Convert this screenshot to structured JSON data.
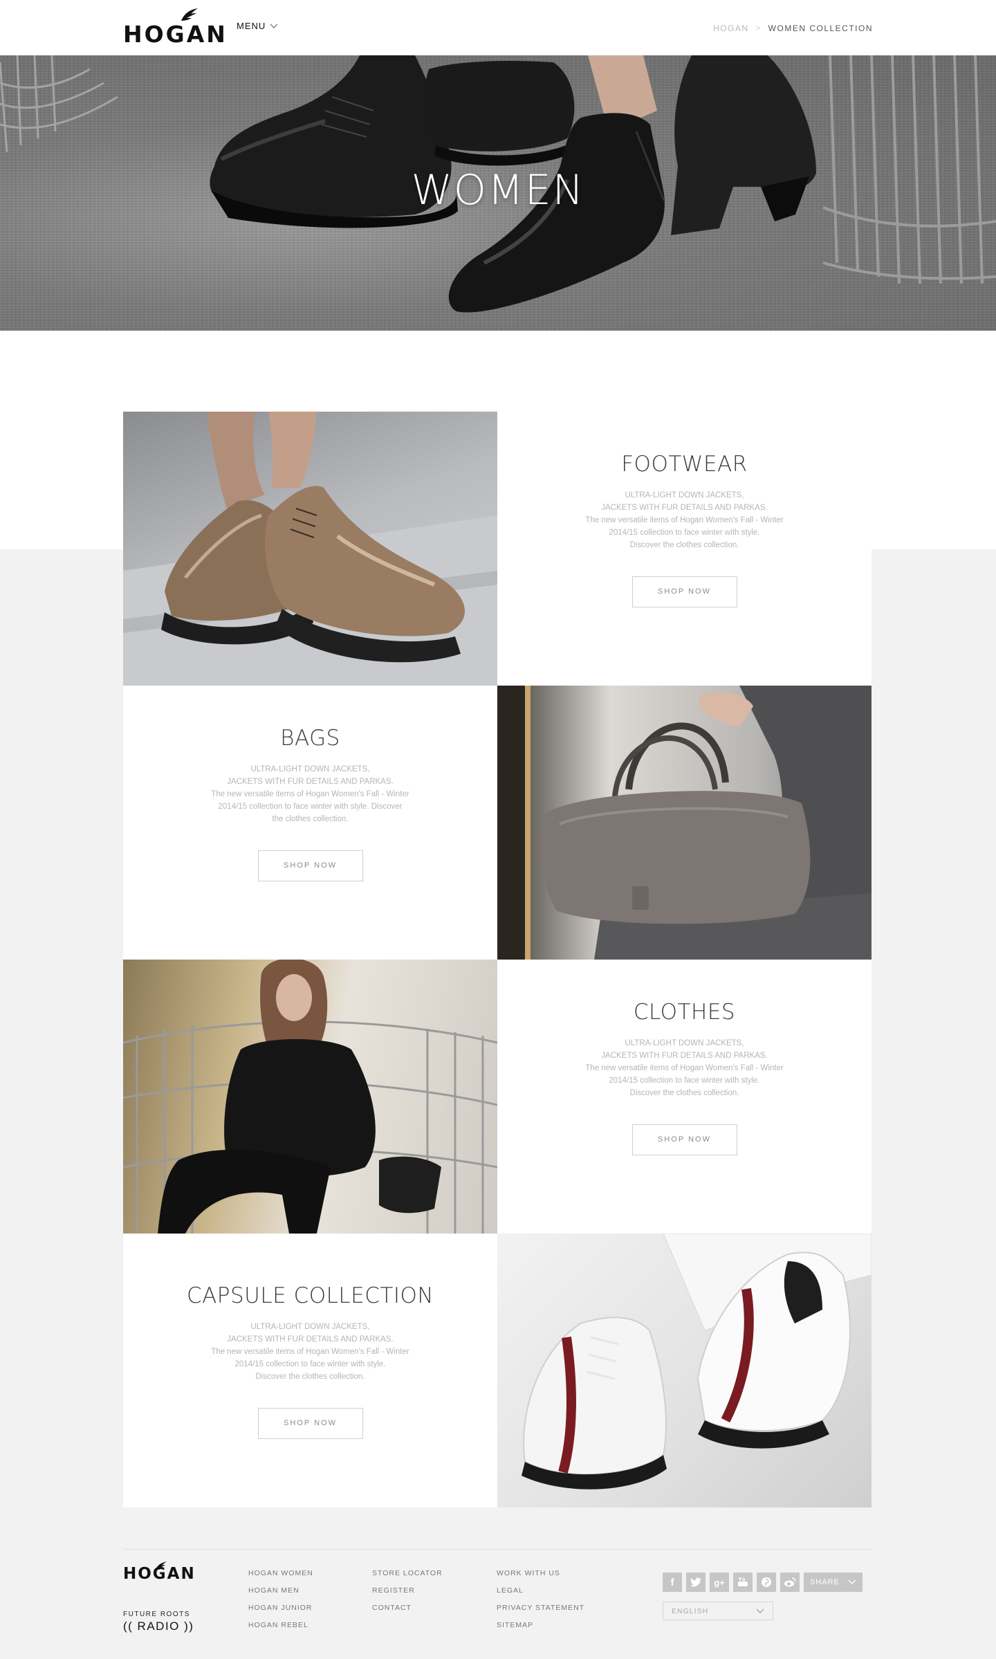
{
  "header": {
    "logo": "HOGAN",
    "menu_label": "MENU",
    "breadcrumb": {
      "home": "HOGAN",
      "separator": ">",
      "current": "WOMEN COLLECTION"
    }
  },
  "hero": {
    "title": "WOMEN"
  },
  "sections": [
    {
      "title": "FOOTWEAR",
      "desc_1": "ULTRA-LIGHT DOWN JACKETS,",
      "desc_2": "JACKETS WITH FUR DETAILS AND PARKAS.",
      "desc_3": "The new versatile items of Hogan Women's Fall - Winter 2014/15 collection to face winter with style.",
      "desc_4": "Discover the clothes collection.",
      "button": "SHOP NOW"
    },
    {
      "title": "BAGS",
      "desc_1": "ULTRA-LIGHT DOWN JACKETS,",
      "desc_2": "JACKETS WITH FUR DETAILS AND PARKAS.",
      "desc_3": "The new versatile items of Hogan Women's Fall - Winter 2014/15 collection to face winter with style. Discover",
      "desc_4": "the clothes collection.",
      "button": "SHOP NOW"
    },
    {
      "title": "CLOTHES",
      "desc_1": "ULTRA-LIGHT DOWN JACKETS,",
      "desc_2": "JACKETS WITH FUR DETAILS AND PARKAS.",
      "desc_3": "The new versatile items of Hogan Women's Fall - Winter 2014/15 collection to face winter with style.",
      "desc_4": "Discover the clothes collection.",
      "button": "SHOP NOW"
    },
    {
      "title": "CAPSULE COLLECTION",
      "desc_1": "ULTRA-LIGHT DOWN JACKETS,",
      "desc_2": "JACKETS WITH FUR DETAILS AND PARKAS.",
      "desc_3": "The new versatile items of Hogan Women's Fall - Winter 2014/15 collection to face winter with style.",
      "desc_4": "Discover the clothes collection.",
      "button": "SHOP NOW"
    }
  ],
  "footer": {
    "logo": "HOGAN",
    "radio_top": "FUTURE ROOTS",
    "radio_bottom": "(( RADIO ))",
    "col1": [
      "HOGAN WOMEN",
      "HOGAN MEN",
      "HOGAN JUNIOR",
      "HOGAN REBEL"
    ],
    "col2": [
      "STORE LOCATOR",
      "REGISTER",
      "CONTACT"
    ],
    "col3": [
      "WORK WITH US",
      "LEGAL",
      "PRIVACY STATEMENT",
      "SITEMAP"
    ],
    "social_icons": [
      "facebook-icon",
      "twitter-icon",
      "google-plus-icon",
      "youtube-icon",
      "pinterest-icon",
      "weibo-icon"
    ],
    "share_label": "SHARE",
    "language": "ENGLISH"
  }
}
